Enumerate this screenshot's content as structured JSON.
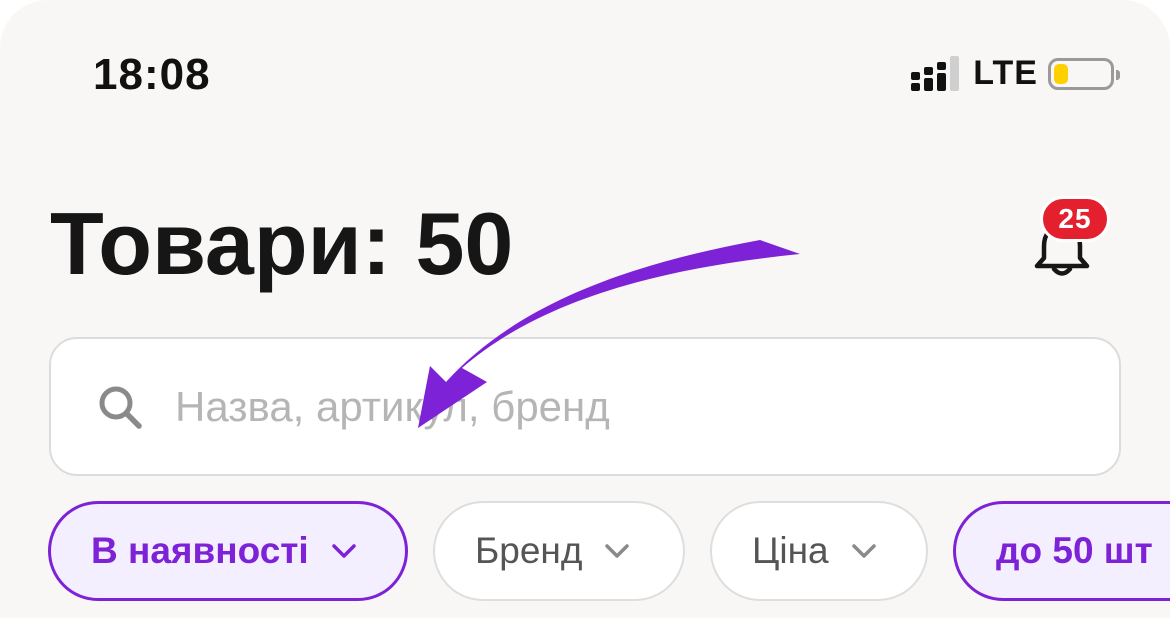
{
  "status_bar": {
    "time": "18:08",
    "network": "LTE",
    "battery_level": 0.25,
    "battery_color": "#ffd000"
  },
  "header": {
    "title": "Товари: 50",
    "notification_icon": "bell-icon",
    "notification_count": "25",
    "badge_color": "#e5202e"
  },
  "search": {
    "placeholder": "Назва, артикул, бренд",
    "value": "",
    "icon": "search-icon"
  },
  "filters": [
    {
      "label": "В наявності",
      "active": true,
      "dropdown": true
    },
    {
      "label": "Бренд",
      "active": false,
      "dropdown": true
    },
    {
      "label": "Ціна",
      "active": false,
      "dropdown": true
    },
    {
      "label": "до 50 шт",
      "active": true,
      "dropdown": false
    }
  ],
  "colors": {
    "accent": "#7d22d6",
    "background": "#f8f7f5",
    "annotation_arrow": "#7d22d6"
  }
}
